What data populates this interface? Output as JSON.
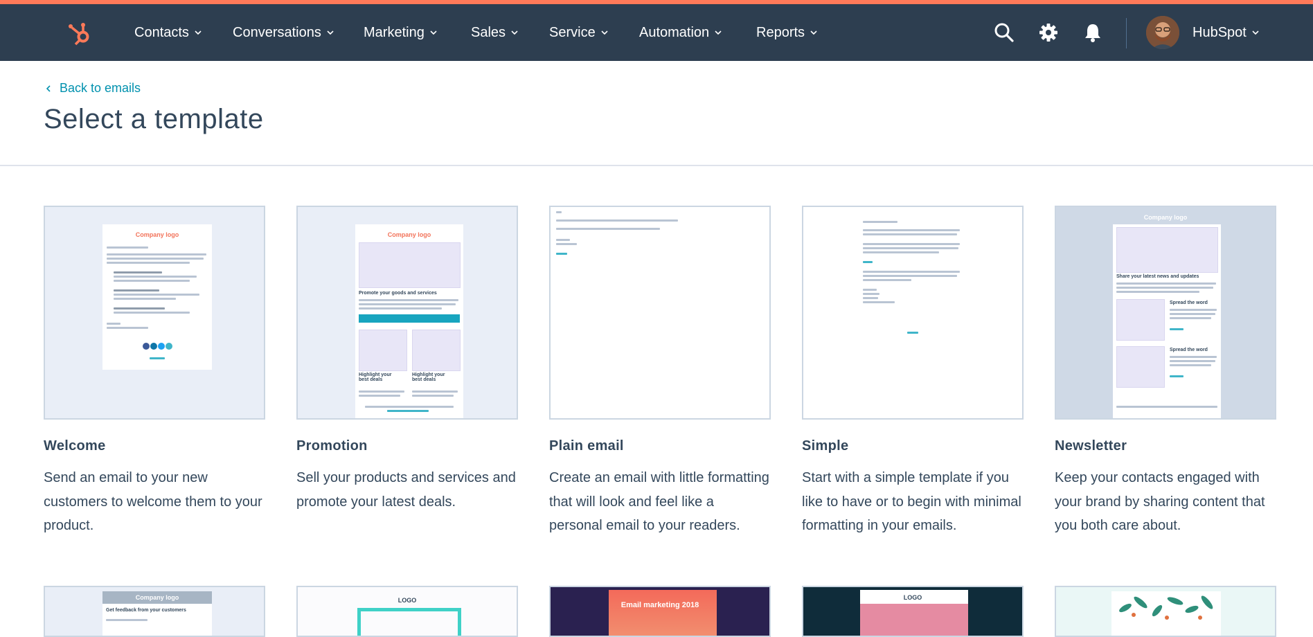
{
  "nav": {
    "items": [
      {
        "label": "Contacts"
      },
      {
        "label": "Conversations"
      },
      {
        "label": "Marketing"
      },
      {
        "label": "Sales"
      },
      {
        "label": "Service"
      },
      {
        "label": "Automation"
      },
      {
        "label": "Reports"
      }
    ],
    "icons": [
      "search-icon",
      "gear-icon",
      "bell-icon"
    ],
    "account_label": "HubSpot",
    "accent_color": "#ff7a59",
    "bar_color": "#2d3e50"
  },
  "page": {
    "back_link": "Back to emails",
    "title": "Select a template"
  },
  "templates": [
    {
      "name": "Welcome",
      "description": "Send an email to your new customers to welcome them to your product.",
      "thumb_logo": "Company logo"
    },
    {
      "name": "Promotion",
      "description": "Sell your products and services and promote your latest deals.",
      "thumb_logo": "Company logo",
      "thumb_heading": "Promote your goods and services",
      "thumb_sub_a": "Highlight your best deals",
      "thumb_sub_b": "Highlight your best deals"
    },
    {
      "name": "Plain email",
      "description": "Create an email with little formatting that will look and feel like a personal email to your readers."
    },
    {
      "name": "Simple",
      "description": "Start with a simple template if you like to have or to begin with minimal formatting in your emails."
    },
    {
      "name": "Newsletter",
      "description": "Keep your contacts engaged with your brand by sharing content that you both care about.",
      "thumb_logo": "Company logo",
      "thumb_heading": "Share your latest news and updates",
      "thumb_sub_a": "Spread the word",
      "thumb_sub_b": "Spread the word"
    }
  ],
  "second_row": [
    {
      "thumb_logo": "Company logo",
      "thumb_heading": "Get feedback from your customers"
    },
    {
      "thumb_logo": "LOGO"
    },
    {
      "thumb_heading": "Email marketing 2018"
    },
    {
      "thumb_logo": "LOGO"
    },
    {}
  ]
}
